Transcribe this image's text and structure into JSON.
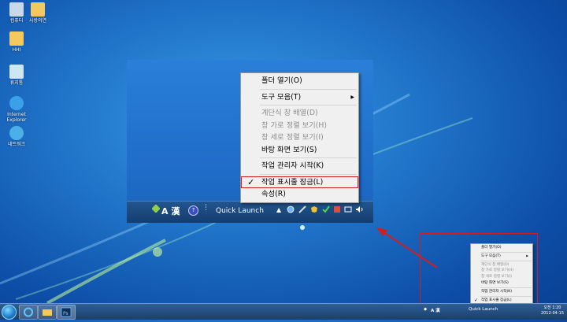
{
  "desktop_icons": [
    {
      "label": "컴퓨터",
      "icon": "computer-icon"
    },
    {
      "label": "사방의연",
      "icon": "folder-icon"
    },
    {
      "label": "HHI",
      "icon": "folder-icon"
    },
    {
      "label": "휴지통",
      "icon": "recycle-bin-icon"
    },
    {
      "label": "Internet Explorer",
      "icon": "ie-icon"
    },
    {
      "label": "네트워크",
      "icon": "network-icon"
    }
  ],
  "context_menu": {
    "items": [
      {
        "label": "폴더 열기(O)",
        "disabled": false,
        "submenu": false,
        "checked": false
      },
      {
        "sep": true
      },
      {
        "label": "도구 모음(T)",
        "disabled": false,
        "submenu": true,
        "checked": false
      },
      {
        "sep": true
      },
      {
        "label": "계단식 창 배열(D)",
        "disabled": true,
        "submenu": false,
        "checked": false
      },
      {
        "label": "창 가로 정렬 보기(H)",
        "disabled": true,
        "submenu": false,
        "checked": false
      },
      {
        "label": "창 세로 정렬 보기(I)",
        "disabled": true,
        "submenu": false,
        "checked": false
      },
      {
        "label": "바탕 화면 보기(S)",
        "disabled": false,
        "submenu": false,
        "checked": false
      },
      {
        "sep": true
      },
      {
        "label": "작업 관리자 시작(K)",
        "disabled": false,
        "submenu": false,
        "checked": false
      },
      {
        "sep": true
      },
      {
        "label": "작업 표시줄 잠금(L)",
        "disabled": false,
        "submenu": false,
        "checked": true,
        "highlight": true
      },
      {
        "label": "속성(R)",
        "disabled": false,
        "submenu": false,
        "checked": false
      }
    ]
  },
  "zoom_taskbar": {
    "ime_label": "A 漢",
    "quick_launch": "Quick Launch",
    "help_icon": "?"
  },
  "clock": {
    "time": "오전 1:20",
    "date": "2012-04-15"
  },
  "mini_quick_launch": "Quick Launch",
  "colors": {
    "annotation": "#d51d1d",
    "menu_bg": "#f0f0f0"
  }
}
